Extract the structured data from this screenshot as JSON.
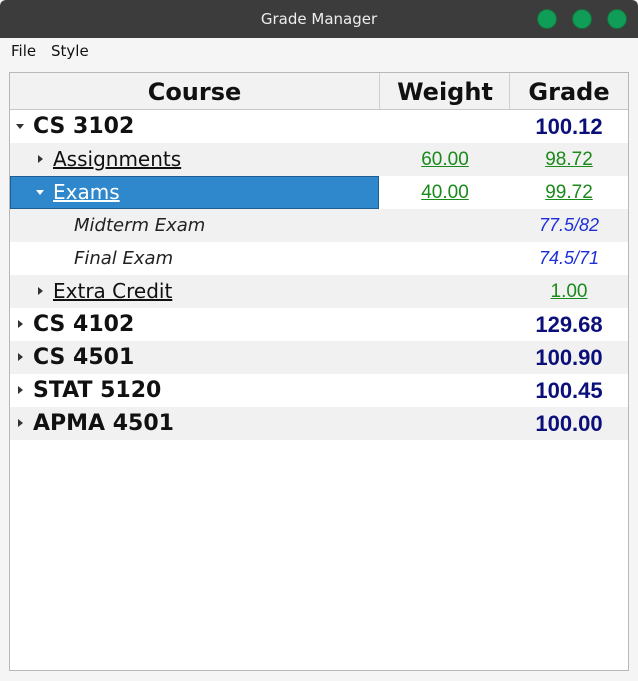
{
  "window": {
    "title": "Grade Manager",
    "buttons": [
      "minimize",
      "maximize",
      "close"
    ]
  },
  "menu": {
    "items": [
      {
        "label": "File"
      },
      {
        "label": "Style"
      }
    ]
  },
  "colors": {
    "titlebar": "#3c3c3c",
    "window_button": "#0f9d58",
    "selection": "#3088cc",
    "weight_text": "#1a8a1a",
    "course_grade_text": "#0b0f7a",
    "item_grade_text": "#1f2fd8"
  },
  "tree": {
    "columns": [
      "Course",
      "Weight",
      "Grade"
    ],
    "rows": [
      {
        "level": 0,
        "expanded": true,
        "name": "CS 3102",
        "weight": "",
        "grade": "100.12"
      },
      {
        "level": 1,
        "expanded": false,
        "name": "Assignments",
        "weight": "60.00",
        "grade": "98.72"
      },
      {
        "level": 1,
        "expanded": true,
        "name": "Exams",
        "weight": "40.00",
        "grade": "99.72",
        "selected": true
      },
      {
        "level": 2,
        "name": "Midterm Exam",
        "weight": "",
        "grade": "77.5/82"
      },
      {
        "level": 2,
        "name": "Final Exam",
        "weight": "",
        "grade": "74.5/71"
      },
      {
        "level": 1,
        "expanded": false,
        "name": "Extra Credit",
        "weight": "",
        "grade": "1.00"
      },
      {
        "level": 0,
        "expanded": false,
        "name": "CS 4102",
        "weight": "",
        "grade": "129.68"
      },
      {
        "level": 0,
        "expanded": false,
        "name": "CS 4501",
        "weight": "",
        "grade": "100.90"
      },
      {
        "level": 0,
        "expanded": false,
        "name": "STAT 5120",
        "weight": "",
        "grade": "100.45"
      },
      {
        "level": 0,
        "expanded": false,
        "name": "APMA 4501",
        "weight": "",
        "grade": "100.00"
      }
    ]
  }
}
